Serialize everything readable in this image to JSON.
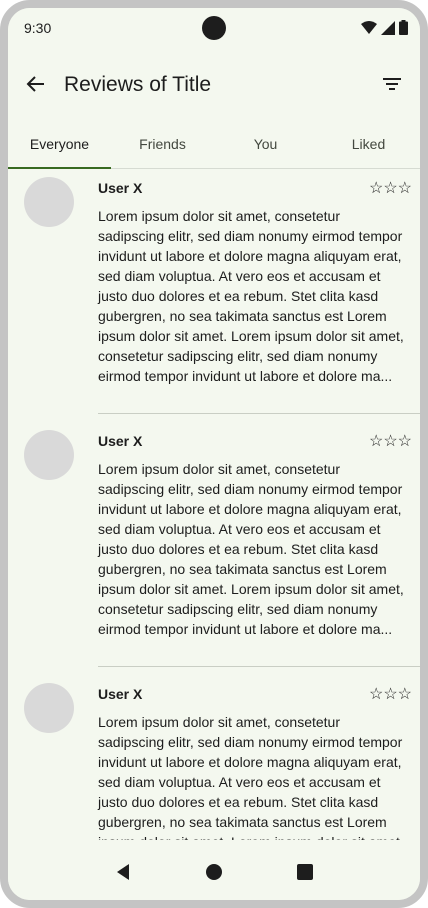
{
  "status_bar": {
    "time": "9:30",
    "icons": [
      "wifi-icon",
      "signal-icon",
      "battery-icon"
    ]
  },
  "app_bar": {
    "title": "Reviews of Title",
    "back_icon": "arrow-back-icon",
    "filter_icon": "filter-icon"
  },
  "tabs": [
    {
      "label": "Everyone",
      "active": true
    },
    {
      "label": "Friends",
      "active": false
    },
    {
      "label": "You",
      "active": false
    },
    {
      "label": "Liked",
      "active": false
    }
  ],
  "reviews": [
    {
      "user": "User X",
      "stars": "☆☆☆",
      "text": "Lorem ipsum dolor sit amet, consetetur sadipscing elitr, sed diam nonumy eirmod tempor invidunt ut labore et dolore magna aliquyam erat, sed diam voluptua. At vero eos et accusam et justo duo dolores et ea rebum. Stet clita kasd gubergren, no sea takimata sanctus est Lorem ipsum dolor sit amet. Lorem ipsum dolor sit amet, consetetur sadipscing elitr, sed diam nonumy eirmod tempor invidunt ut labore et dolore ma..."
    },
    {
      "user": "User X",
      "stars": "☆☆☆",
      "text": "Lorem ipsum dolor sit amet, consetetur sadipscing elitr, sed diam nonumy eirmod tempor invidunt ut labore et dolore magna aliquyam erat, sed diam voluptua. At vero eos et accusam et justo duo dolores et ea rebum. Stet clita kasd gubergren, no sea takimata sanctus est Lorem ipsum dolor sit amet. Lorem ipsum dolor sit amet, consetetur sadipscing elitr, sed diam nonumy eirmod tempor invidunt ut labore et dolore ma..."
    },
    {
      "user": "User X",
      "stars": "☆☆☆",
      "text": "Lorem ipsum dolor sit amet, consetetur sadipscing elitr, sed diam nonumy eirmod tempor invidunt ut labore et dolore magna aliquyam erat, sed diam voluptua. At vero eos et accusam et justo duo dolores et ea rebum. Stet clita kasd gubergren, no sea takimata sanctus est Lorem ipsum dolor sit amet. Lorem ipsum dolor sit amet, consetetur sadipscing elitr, sed diam nonumy eirmod tempor invidunt ut labore et dolore ma..."
    }
  ],
  "nav_bar": {
    "icons": [
      "back-triangle-icon",
      "home-circle-icon",
      "recents-square-icon"
    ]
  },
  "colors": {
    "background": "#f4f8ef",
    "accent": "#386a20",
    "avatar": "#d9d9d9"
  }
}
